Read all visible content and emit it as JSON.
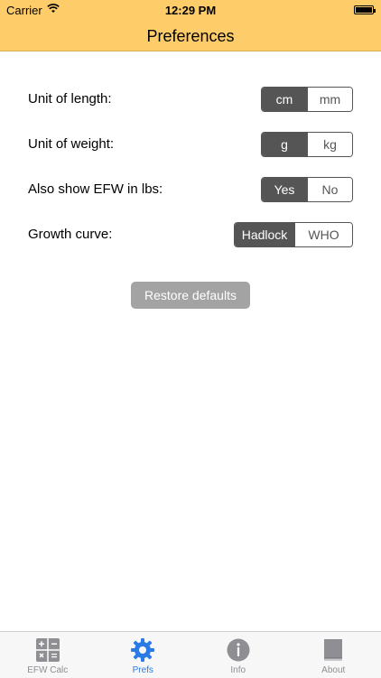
{
  "status_bar": {
    "carrier": "Carrier",
    "time": "12:29 PM"
  },
  "header": {
    "title": "Preferences"
  },
  "preferences": [
    {
      "label": "Unit of length:",
      "options": [
        "cm",
        "mm"
      ],
      "selected": "cm"
    },
    {
      "label": "Unit of weight:",
      "options": [
        "g",
        "kg"
      ],
      "selected": "g"
    },
    {
      "label": "Also show EFW in lbs:",
      "options": [
        "Yes",
        "No"
      ],
      "selected": "Yes"
    },
    {
      "label": "Growth curve:",
      "options": [
        "Hadlock",
        "WHO"
      ],
      "selected": "Hadlock"
    }
  ],
  "restore_button": {
    "label": "Restore defaults"
  },
  "tabbar": {
    "items": [
      {
        "label": "EFW Calc",
        "icon": "calculator-icon",
        "active": false
      },
      {
        "label": "Prefs",
        "icon": "gear-icon",
        "active": true
      },
      {
        "label": "Info",
        "icon": "info-icon",
        "active": false
      },
      {
        "label": "About",
        "icon": "book-icon",
        "active": false
      }
    ]
  },
  "colors": {
    "header": "#fecd6a",
    "accent": "#2c7be5",
    "segment_selected": "#555555",
    "button": "#a3a3a3"
  }
}
